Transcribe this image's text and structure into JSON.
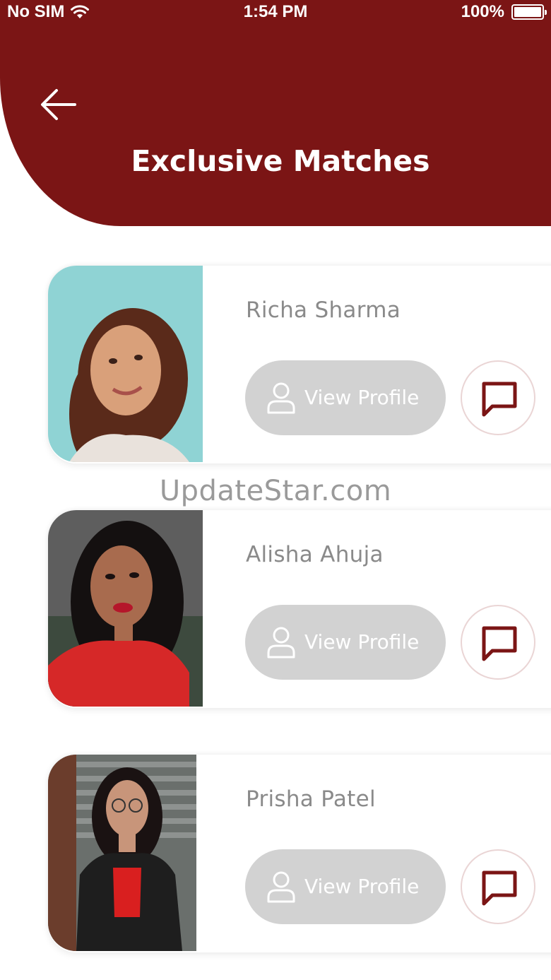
{
  "status_bar": {
    "carrier": "No SIM",
    "time": "1:54 PM",
    "battery": "100%"
  },
  "header": {
    "title": "Exclusive Matches"
  },
  "matches": [
    {
      "name": "Richa Sharma",
      "button_label": "View Profile"
    },
    {
      "name": "Alisha Ahuja",
      "button_label": "View Profile"
    },
    {
      "name": "Prisha Patel",
      "button_label": "View Profile"
    }
  ],
  "watermark": "UpdateStar.com",
  "colors": {
    "header": "#7b1515",
    "button": "#d2d2d2",
    "chat_icon": "#7b1515",
    "name_text": "#8a8a8a"
  },
  "icons": {
    "back": "arrow-left-icon",
    "profile": "user-icon",
    "chat": "chat-bubble-icon",
    "wifi": "wifi-icon",
    "battery": "battery-icon"
  }
}
